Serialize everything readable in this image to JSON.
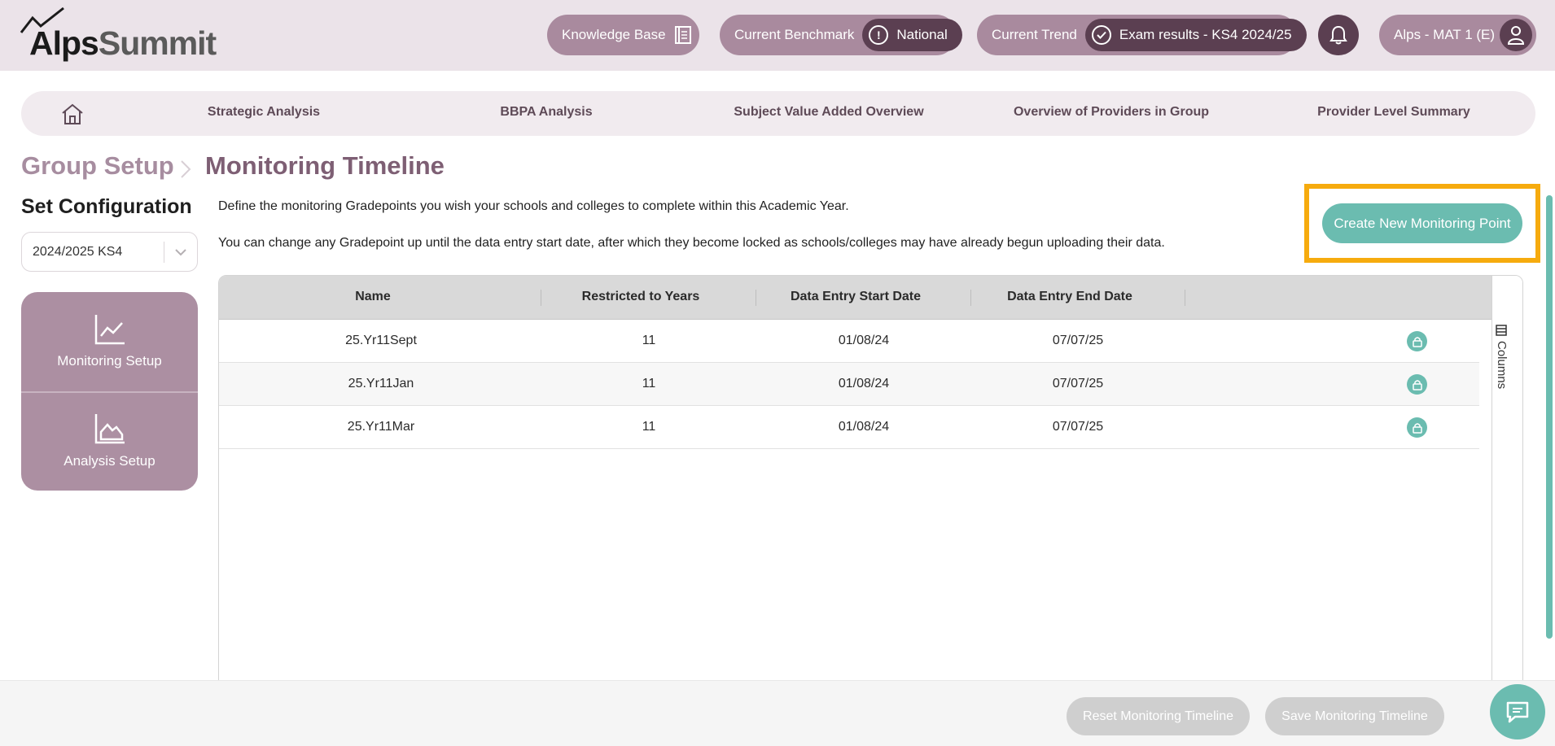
{
  "brand": {
    "alps": "Alps",
    "summit": "Summit"
  },
  "header": {
    "knowledge_base": "Knowledge Base",
    "benchmark_label": "Current Benchmark",
    "benchmark_value": "National",
    "trend_label": "Current Trend",
    "trend_value": "Exam results - KS4 2024/25",
    "user": "Alps - MAT 1 (E)"
  },
  "nav": {
    "items": [
      "Strategic Analysis",
      "BBPA Analysis",
      "Subject Value Added Overview",
      "Overview of Providers in Group",
      "Provider Level Summary"
    ]
  },
  "breadcrumb": {
    "parent": "Group Setup",
    "current": "Monitoring Timeline"
  },
  "config": {
    "title": "Set Configuration",
    "selected": "2024/2025 KS4",
    "menu": [
      "Monitoring Setup",
      "Analysis Setup"
    ]
  },
  "main": {
    "description_1": "Define the monitoring Gradepoints you wish your schools and colleges to complete within this Academic Year.",
    "description_2": "You can change any Gradepoint up until the data entry start date, after which they become locked as schools/colleges may have already begun uploading their data.",
    "create_button": "Create New Monitoring Point"
  },
  "table": {
    "columns": [
      "Name",
      "Restricted to Years",
      "Data Entry Start Date",
      "Data Entry End Date"
    ],
    "rows": [
      [
        "25.Yr11Sept",
        "11",
        "01/08/24",
        "07/07/25"
      ],
      [
        "25.Yr11Jan",
        "11",
        "01/08/24",
        "07/07/25"
      ],
      [
        "25.Yr11Mar",
        "11",
        "01/08/24",
        "07/07/25"
      ]
    ],
    "side_panel": "Columns"
  },
  "footer": {
    "reset": "Reset Monitoring Timeline",
    "save": "Save Monitoring Timeline"
  },
  "colors": {
    "accent": "#6bbcb0",
    "brand": "#a98a9e",
    "brand_dark": "#5b3f51",
    "highlight": "#f6ab0e"
  },
  "icons": [
    "chart-line-icon",
    "book-icon",
    "alert-circle-icon",
    "check-circle-icon",
    "bell-icon",
    "user-icon",
    "home-icon",
    "chevron-down-icon",
    "line-chart-icon",
    "area-chart-icon",
    "lock-icon",
    "columns-icon",
    "chat-icon"
  ]
}
